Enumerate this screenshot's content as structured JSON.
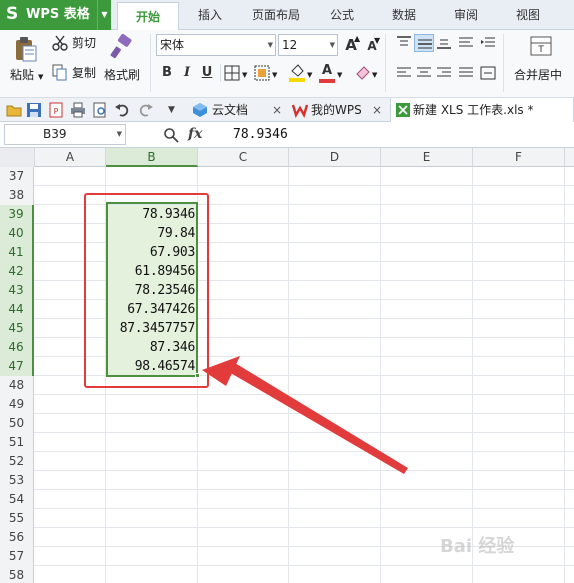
{
  "app": {
    "logo": "S",
    "name": "WPS 表格"
  },
  "tabs": [
    "开始",
    "插入",
    "页面布局",
    "公式",
    "数据",
    "审阅",
    "视图"
  ],
  "ribbon": {
    "paste": "粘贴",
    "cut": "剪切",
    "copy": "复制",
    "format_painter": "格式刷",
    "font_name": "宋体",
    "font_size": "12",
    "merge_center": "合并居中",
    "bold": "B",
    "italic": "I",
    "underline": "U",
    "grow_font": "A",
    "shrink_font": "A",
    "font_color_letter": "A"
  },
  "doc_tabs": [
    {
      "label": "云文档",
      "icon": "cloud-doc-icon"
    },
    {
      "label": "我的WPS",
      "icon": "wps-logo-icon"
    },
    {
      "label": "新建 XLS 工作表.xls *",
      "icon": "sheet-file-icon"
    }
  ],
  "formula_bar": {
    "cell_ref": "B39",
    "fx": "fx",
    "value": "78.9346"
  },
  "columns": [
    "A",
    "B",
    "C",
    "D",
    "E",
    "F"
  ],
  "rows": [
    {
      "n": "37",
      "b": ""
    },
    {
      "n": "38",
      "b": ""
    },
    {
      "n": "39",
      "b": "78.9346"
    },
    {
      "n": "40",
      "b": "79.84"
    },
    {
      "n": "41",
      "b": "67.903"
    },
    {
      "n": "42",
      "b": "61.89456"
    },
    {
      "n": "43",
      "b": "78.23546"
    },
    {
      "n": "44",
      "b": "67.347426"
    },
    {
      "n": "45",
      "b": "87.3457757"
    },
    {
      "n": "46",
      "b": "87.346"
    },
    {
      "n": "47",
      "b": "98.46574"
    },
    {
      "n": "48",
      "b": ""
    },
    {
      "n": "49",
      "b": ""
    },
    {
      "n": "50",
      "b": ""
    },
    {
      "n": "51",
      "b": ""
    },
    {
      "n": "52",
      "b": ""
    },
    {
      "n": "53",
      "b": ""
    },
    {
      "n": "54",
      "b": ""
    },
    {
      "n": "55",
      "b": ""
    },
    {
      "n": "56",
      "b": ""
    },
    {
      "n": "57",
      "b": ""
    },
    {
      "n": "58",
      "b": ""
    }
  ],
  "selected_rows": [
    "39",
    "40",
    "41",
    "42",
    "43",
    "44",
    "45",
    "46",
    "47"
  ],
  "watermark": "Bai 经验",
  "colors": {
    "accent": "#3c9a3c",
    "selection": "#4d8f3f",
    "annotation": "#e23b3b"
  }
}
